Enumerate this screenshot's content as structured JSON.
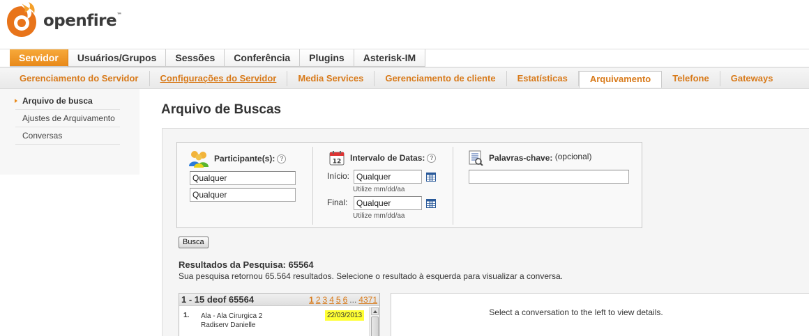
{
  "header": {
    "logo_text": "openfire",
    "logo_tm": "™"
  },
  "main_tabs": [
    {
      "label": "Servidor",
      "active": true
    },
    {
      "label": "Usuários/Grupos",
      "active": false
    },
    {
      "label": "Sessões",
      "active": false
    },
    {
      "label": "Conferência",
      "active": false
    },
    {
      "label": "Plugins",
      "active": false
    },
    {
      "label": "Asterisk-IM",
      "active": false
    }
  ],
  "sub_tabs": [
    {
      "label": "Gerenciamento do Servidor"
    },
    {
      "label": "Configurações do Servidor"
    },
    {
      "label": "Media Services"
    },
    {
      "label": "Gerenciamento de cliente"
    },
    {
      "label": "Estatísticas"
    },
    {
      "label": "Arquivamento"
    },
    {
      "label": "Telefone"
    },
    {
      "label": "Gateways"
    }
  ],
  "sidebar": {
    "items": [
      {
        "label": "Arquivo de busca",
        "active": true
      },
      {
        "label": "Ajustes de Arquivamento",
        "active": false
      },
      {
        "label": "Conversas",
        "active": false
      }
    ]
  },
  "page_title": "Arquivo de Buscas",
  "search": {
    "participants_label": "Participante(s):",
    "participant1_value": "Qualquer",
    "participant2_value": "Qualquer",
    "date_label": "Intervalo de Datas:",
    "start_label": "Início:",
    "start_value": "Qualquer",
    "start_hint": "Utilize mm/dd/aa",
    "end_label": "Final:",
    "end_value": "Qualquer",
    "end_hint": "Utilize mm/dd/aa",
    "keywords_label": "Palavras-chave:",
    "keywords_optional": "(opcional)",
    "keywords_value": "",
    "help_glyph": "?",
    "calendar_day": "12",
    "button_label": "Busca"
  },
  "results": {
    "title": "Resultados da Pesquisa: 65564",
    "description": "Sua pesquisa retornou 65.564 resultados. Selecione o resultado à esquerda para visualizar a conversa.",
    "range_label": "1 - 15 deof 65564",
    "pages": [
      "1",
      "2",
      "3",
      "4",
      "5",
      "6"
    ],
    "ellipsis": "...",
    "last_page": "4371",
    "rows": [
      {
        "num": "1.",
        "line1": "Ala - Ala Cirurgica 2",
        "line2": "Radiserv Danielle",
        "date": "22/03/2013"
      }
    ]
  },
  "details": {
    "placeholder": "Select a conversation to the left to view details."
  },
  "colors": {
    "accent": "#e8891a",
    "link": "#d87a1a",
    "highlight": "#ffff33"
  }
}
